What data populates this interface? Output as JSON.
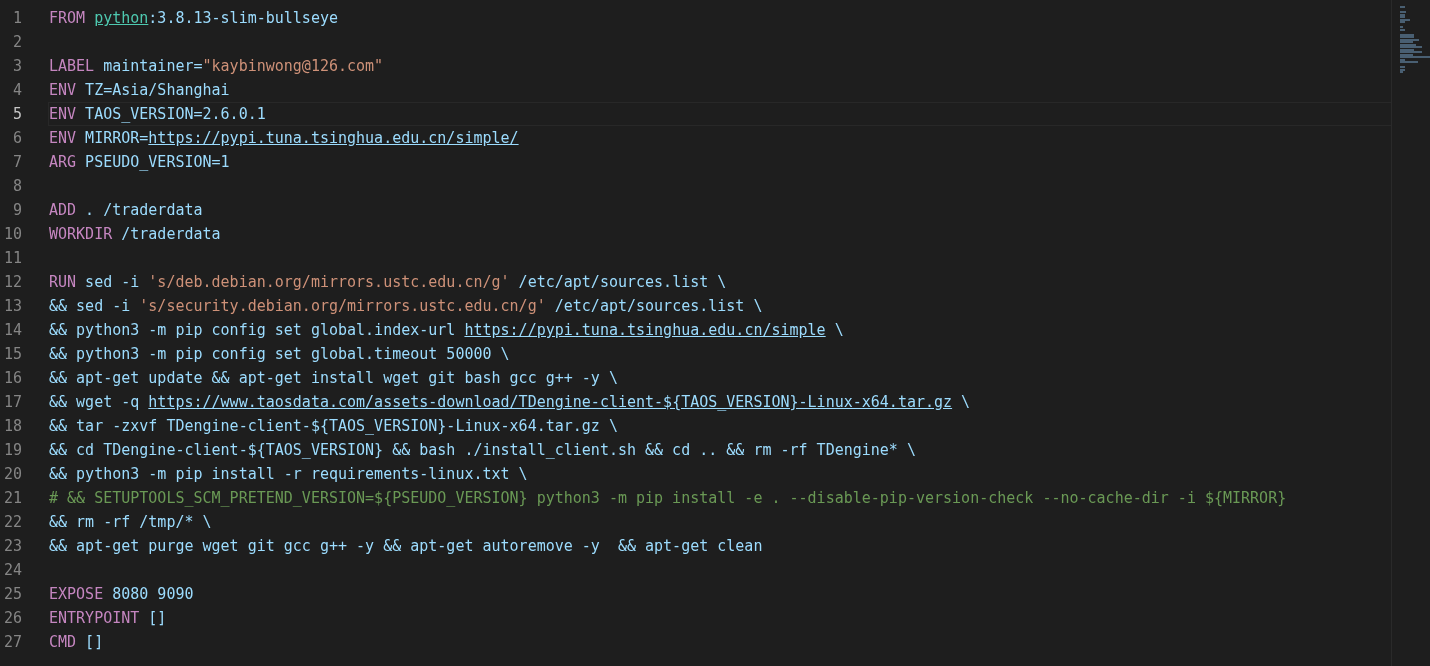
{
  "editor": {
    "lines": [
      {
        "number": "1",
        "current": false,
        "tokens": [
          {
            "kind": "keyword",
            "text": "FROM "
          },
          {
            "kind": "image",
            "text": "python"
          },
          {
            "kind": "text",
            "text": ":3.8.13-slim-bullseye"
          }
        ]
      },
      {
        "number": "2",
        "current": false
      },
      {
        "number": "3",
        "current": false,
        "tokens": [
          {
            "kind": "keyword",
            "text": "LABEL"
          },
          {
            "kind": "text",
            "text": " maintainer="
          },
          {
            "kind": "string",
            "text": "\"kaybinwong@126.com\""
          }
        ]
      },
      {
        "number": "4",
        "current": false,
        "tokens": [
          {
            "kind": "keyword",
            "text": "ENV"
          },
          {
            "kind": "text",
            "text": " TZ=Asia/Shanghai"
          }
        ]
      },
      {
        "number": "5",
        "current": true,
        "tokens": [
          {
            "kind": "keyword",
            "text": "ENV"
          },
          {
            "kind": "text",
            "text": " TAOS_VERSION=2.6.0.1"
          }
        ]
      },
      {
        "number": "6",
        "current": false,
        "tokens": [
          {
            "kind": "keyword",
            "text": "ENV"
          },
          {
            "kind": "text",
            "text": " MIRROR="
          },
          {
            "kind": "link",
            "text": "https://pypi.tuna.tsinghua.edu.cn/simple/"
          }
        ]
      },
      {
        "number": "7",
        "current": false,
        "tokens": [
          {
            "kind": "keyword",
            "text": "ARG"
          },
          {
            "kind": "text",
            "text": " PSEUDO_VERSION=1"
          }
        ]
      },
      {
        "number": "8",
        "current": false
      },
      {
        "number": "9",
        "current": false,
        "tokens": [
          {
            "kind": "keyword",
            "text": "ADD"
          },
          {
            "kind": "text",
            "text": " . /traderdata"
          }
        ]
      },
      {
        "number": "10",
        "current": false,
        "tokens": [
          {
            "kind": "keyword",
            "text": "WORKDIR"
          },
          {
            "kind": "text",
            "text": " /traderdata"
          }
        ]
      },
      {
        "number": "11",
        "current": false
      },
      {
        "number": "12",
        "current": false,
        "tokens": [
          {
            "kind": "keyword",
            "text": "RUN"
          },
          {
            "kind": "text",
            "text": " sed -i "
          },
          {
            "kind": "string",
            "text": "'s/deb.debian.org/mirrors.ustc.edu.cn/g'"
          },
          {
            "kind": "text",
            "text": " /etc/apt/sources.list \\"
          }
        ]
      },
      {
        "number": "13",
        "current": false,
        "tokens": [
          {
            "kind": "text",
            "text": "&& sed -i "
          },
          {
            "kind": "string",
            "text": "'s/security.debian.org/mirrors.ustc.edu.cn/g'"
          },
          {
            "kind": "text",
            "text": " /etc/apt/sources.list \\"
          }
        ]
      },
      {
        "number": "14",
        "current": false,
        "tokens": [
          {
            "kind": "text",
            "text": "&& python3 -m pip config set global.index-url "
          },
          {
            "kind": "link",
            "text": "https://pypi.tuna.tsinghua.edu.cn/simple"
          },
          {
            "kind": "text",
            "text": " \\"
          }
        ]
      },
      {
        "number": "15",
        "current": false,
        "tokens": [
          {
            "kind": "text",
            "text": "&& python3 -m pip config set global.timeout 50000 \\"
          }
        ]
      },
      {
        "number": "16",
        "current": false,
        "tokens": [
          {
            "kind": "text",
            "text": "&& apt-get update && apt-get install wget git bash gcc g++ -y \\"
          }
        ]
      },
      {
        "number": "17",
        "current": false,
        "tokens": [
          {
            "kind": "text",
            "text": "&& wget -q "
          },
          {
            "kind": "link",
            "text": "https://www.taosdata.com/assets-download/TDengine-client-${TAOS_VERSION}-Linux-x64.tar.gz"
          },
          {
            "kind": "text",
            "text": " \\"
          }
        ]
      },
      {
        "number": "18",
        "current": false,
        "tokens": [
          {
            "kind": "text",
            "text": "&& tar -zxvf TDengine-client-${TAOS_VERSION}-Linux-x64.tar.gz \\"
          }
        ]
      },
      {
        "number": "19",
        "current": false,
        "tokens": [
          {
            "kind": "text",
            "text": "&& cd TDengine-client-${TAOS_VERSION} && bash ./install_client.sh && cd .. && rm -rf TDengine* \\"
          }
        ]
      },
      {
        "number": "20",
        "current": false,
        "tokens": [
          {
            "kind": "text",
            "text": "&& python3 -m pip install -r requirements-linux.txt \\"
          }
        ]
      },
      {
        "number": "21",
        "current": false,
        "tokens": [
          {
            "kind": "comment",
            "text": "# && SETUPTOOLS_SCM_PRETEND_VERSION=${PSEUDO_VERSION} python3 -m pip install -e . --disable-pip-version-check --no-cache-dir -i ${MIRROR}"
          }
        ]
      },
      {
        "number": "22",
        "current": false,
        "tokens": [
          {
            "kind": "text",
            "text": "&& rm -rf /tmp/* \\"
          }
        ]
      },
      {
        "number": "23",
        "current": false,
        "tokens": [
          {
            "kind": "text",
            "text": "&& apt-get purge wget git gcc g++ -y && apt-get autoremove -y  && apt-get clean"
          }
        ]
      },
      {
        "number": "24",
        "current": false
      },
      {
        "number": "25",
        "current": false,
        "tokens": [
          {
            "kind": "keyword",
            "text": "EXPOSE"
          },
          {
            "kind": "text",
            "text": " 8080 9090"
          }
        ]
      },
      {
        "number": "26",
        "current": false,
        "tokens": [
          {
            "kind": "keyword",
            "text": "ENTRYPOINT"
          },
          {
            "kind": "text",
            "text": " []"
          }
        ]
      },
      {
        "number": "27",
        "current": false,
        "tokens": [
          {
            "kind": "keyword",
            "text": "CMD"
          },
          {
            "kind": "text",
            "text": " []"
          }
        ]
      }
    ]
  }
}
